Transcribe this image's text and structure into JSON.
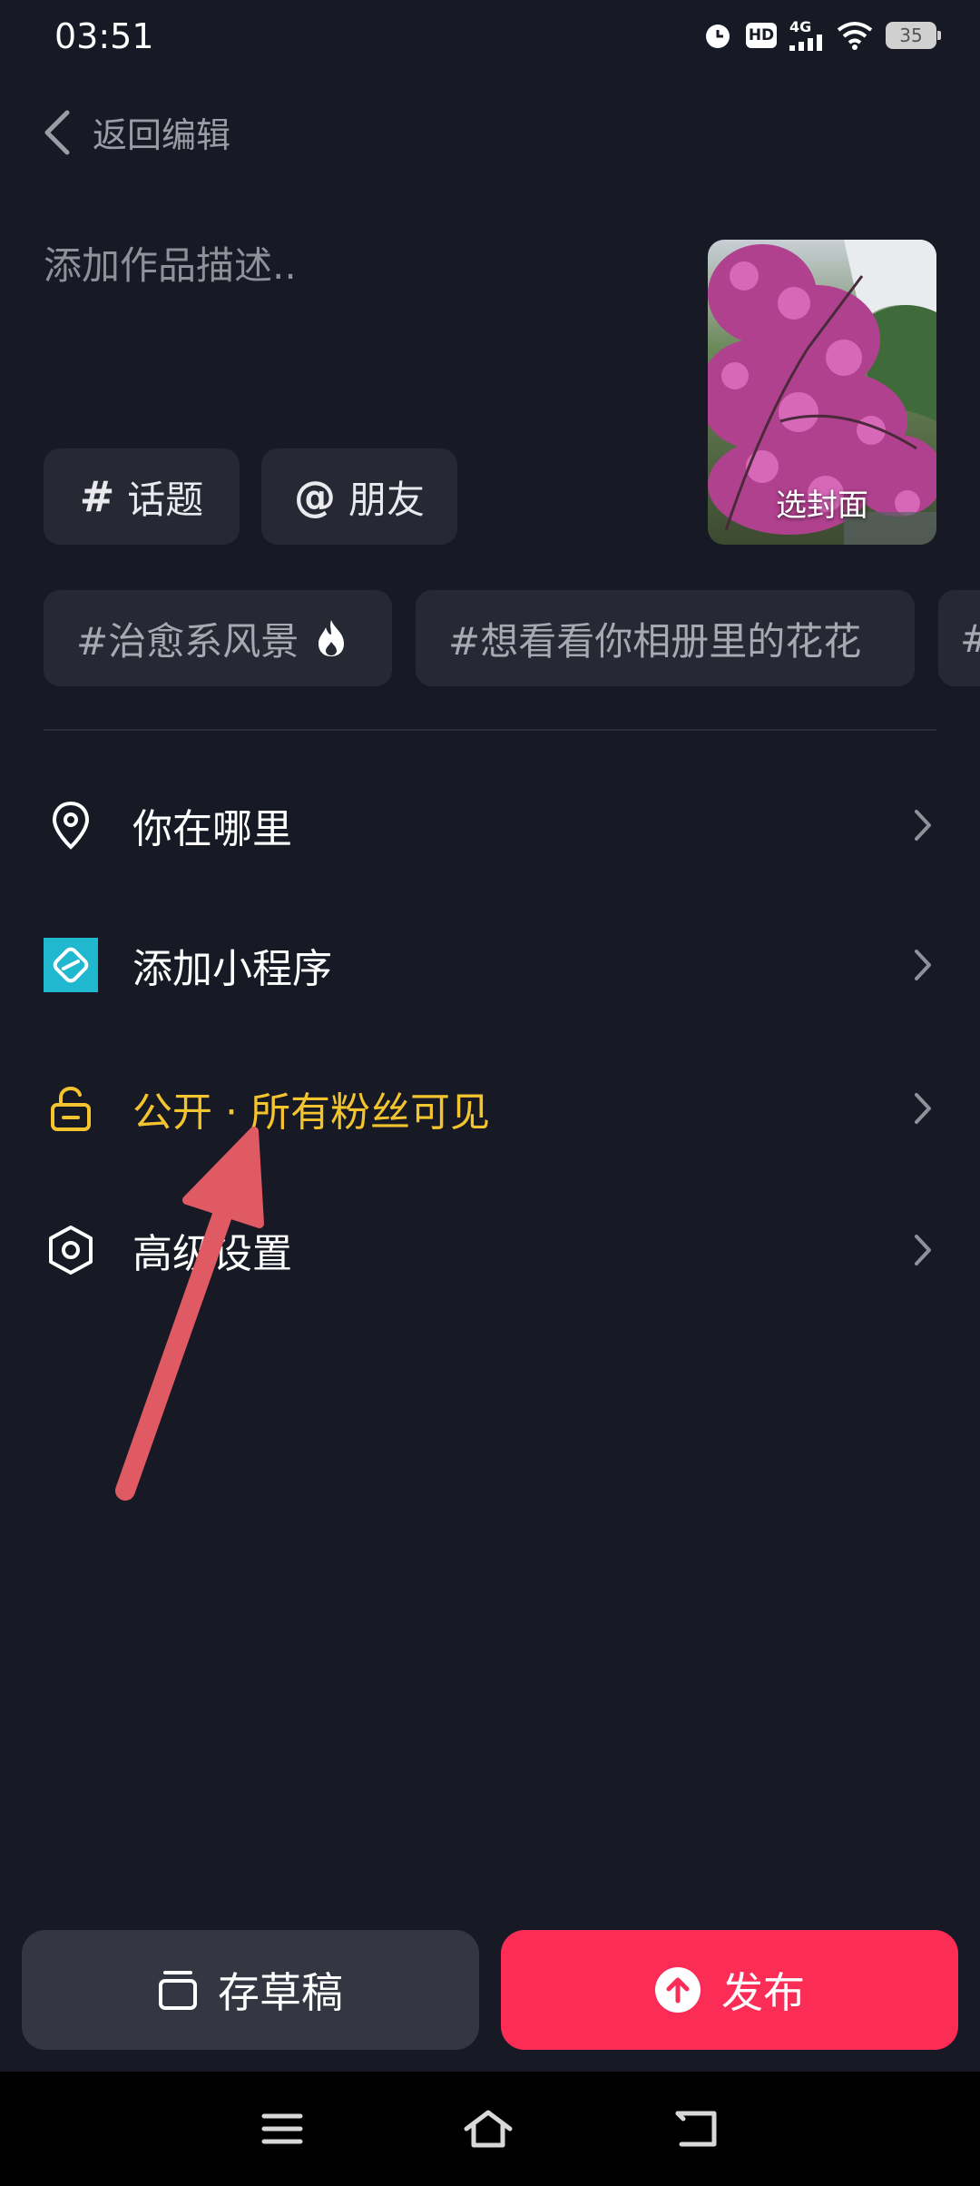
{
  "status_bar": {
    "time": "03:51",
    "hd": "HD",
    "network": "4G",
    "battery": "35"
  },
  "header": {
    "back_label": "返回编辑"
  },
  "description": {
    "placeholder": "添加作品描述.."
  },
  "cover": {
    "label": "选封面"
  },
  "chips": {
    "topic_symbol": "#",
    "topic_label": "话题",
    "friend_symbol": "@",
    "friend_label": "朋友"
  },
  "tags": [
    "#治愈系风景",
    "#想看看你相册里的花花",
    "#"
  ],
  "menu": {
    "location": "你在哪里",
    "mini_program": "添加小程序",
    "visibility": "公开 · 所有粉丝可见",
    "advanced": "高级设置"
  },
  "buttons": {
    "draft": "存草稿",
    "publish": "发布"
  },
  "colors": {
    "accent": "#fb2c55",
    "visibility": "#f3c42e",
    "miniapp": "#1fb8cf",
    "background": "#171924"
  },
  "icons": [
    "back-icon",
    "cover-thumbnail",
    "fire-icon",
    "location-pin-icon",
    "mini-program-icon",
    "lock-open-icon",
    "settings-hexagon-icon",
    "chevron-right-icon",
    "draft-box-icon",
    "upload-arrow-icon",
    "menu-icon",
    "home-icon",
    "back-nav-icon"
  ]
}
